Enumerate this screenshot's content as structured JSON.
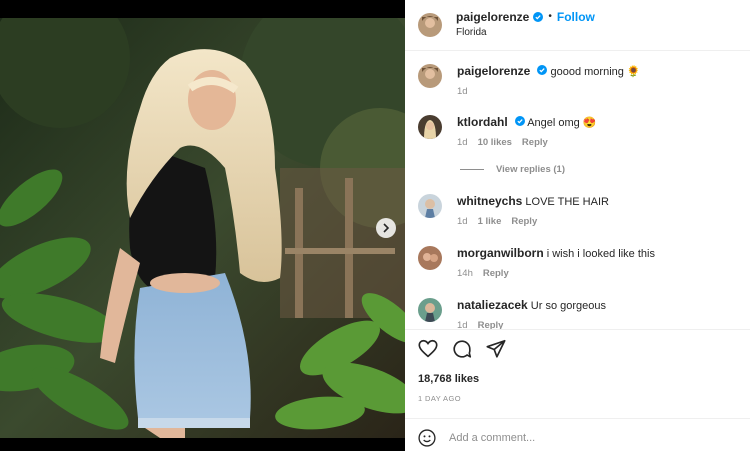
{
  "post": {
    "author": "paigelorenze",
    "location": "Florida",
    "follow_label": "Follow",
    "dot": "•"
  },
  "comments": [
    {
      "user": "paigelorenze",
      "text": "goood morning 🌻",
      "time": "1d",
      "likes": "",
      "reply": ""
    },
    {
      "user": "ktlordahl",
      "text": "Angel omg 😍",
      "time": "1d",
      "likes": "10 likes",
      "reply": "Reply"
    },
    {
      "user": "whitneychs",
      "text": "LOVE THE HAIR",
      "time": "1d",
      "likes": "1 like",
      "reply": "Reply"
    },
    {
      "user": "morganwilborn",
      "text": "i wish i looked like this",
      "time": "14h",
      "likes": "",
      "reply": "Reply"
    },
    {
      "user": "nataliezacek",
      "text": "Ur so gorgeous",
      "time": "1d",
      "likes": "",
      "reply": "Reply"
    }
  ],
  "view_replies": "View replies (1)",
  "likes": "18,768 likes",
  "date": "1 DAY AGO",
  "add_comment_placeholder": "Add a comment...",
  "colors": {
    "accent": "#0095f6",
    "muted": "#8e8e8e",
    "text": "#262626"
  },
  "icons": [
    "verified-badge-icon",
    "heart-icon",
    "comment-icon",
    "share-icon",
    "emoji-icon",
    "next-arrow-icon"
  ]
}
